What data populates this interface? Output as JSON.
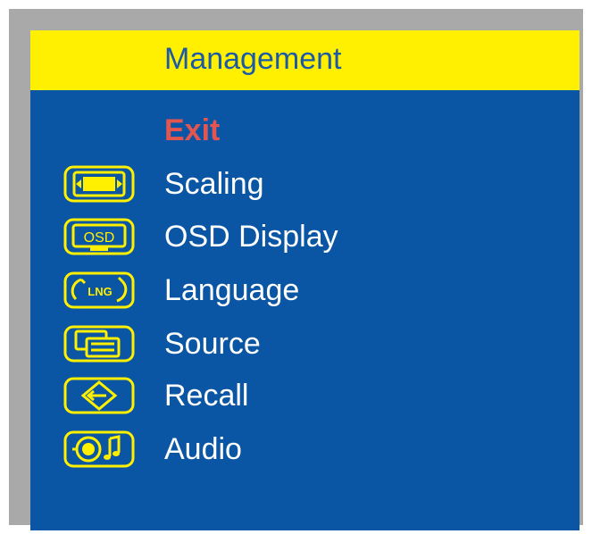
{
  "colors": {
    "background": "#0a56a4",
    "title_bar": "#ffef00",
    "title_text": "#1a5aa6",
    "item_text": "#ffffff",
    "exit_text": "#e5554f",
    "icon_color": "#ffef00"
  },
  "menu": {
    "title": "Management",
    "exit_label": "Exit",
    "items": [
      {
        "label": "Scaling",
        "icon": "scaling-icon"
      },
      {
        "label": "OSD Display",
        "icon": "osd-display-icon"
      },
      {
        "label": "Language",
        "icon": "language-icon"
      },
      {
        "label": "Source",
        "icon": "source-icon"
      },
      {
        "label": "Recall",
        "icon": "recall-icon"
      },
      {
        "label": "Audio",
        "icon": "audio-icon"
      }
    ]
  }
}
